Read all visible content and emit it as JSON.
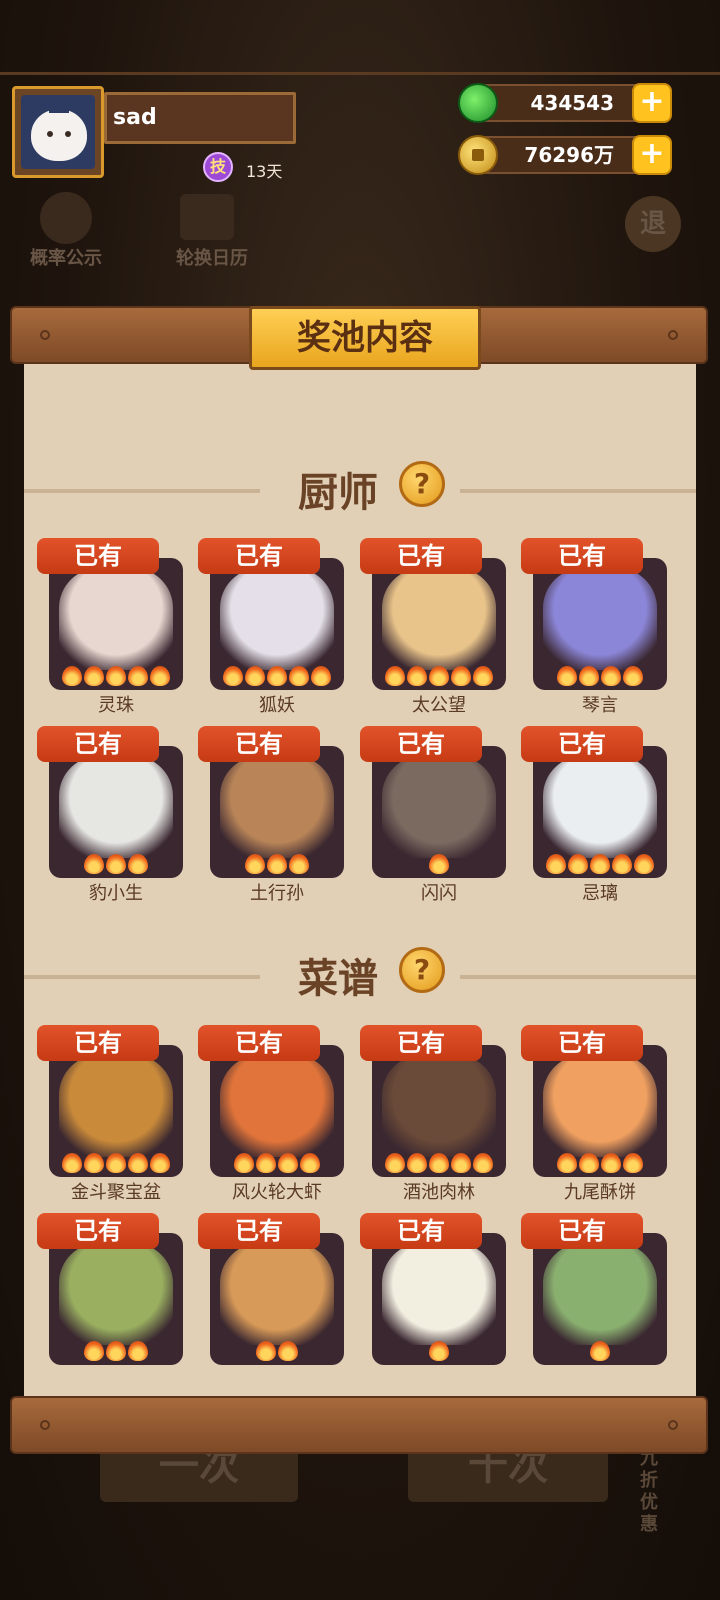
{
  "player": {
    "name": "sad",
    "skill_badge": "技",
    "skill_days": "13天"
  },
  "resources": {
    "jade": "434543",
    "coins": "76296万",
    "plus": "+"
  },
  "background": {
    "probability_label": "概率公示",
    "calendar_label": "轮换日历",
    "exit_label": "退",
    "single_draw": "一次",
    "ten_draw": "十次",
    "discount": "九折优惠"
  },
  "panel": {
    "title": "奖池内容",
    "sections": [
      {
        "title": "厨师",
        "help": "?"
      },
      {
        "title": "菜谱",
        "help": "?"
      }
    ]
  },
  "owned_label": "已有",
  "chefs": [
    {
      "name": "灵珠",
      "stars": 5,
      "art": "#e8d6d0"
    },
    {
      "name": "狐妖",
      "stars": 5,
      "art": "#e4dfe8"
    },
    {
      "name": "太公望",
      "stars": 5,
      "art": "#e9c48a"
    },
    {
      "name": "琴言",
      "stars": 4,
      "art": "#8c86d8"
    },
    {
      "name": "豹小生",
      "stars": 3,
      "art": "#e6e6e2"
    },
    {
      "name": "土行孙",
      "stars": 3,
      "art": "#b88458"
    },
    {
      "name": "闪闪",
      "stars": 1,
      "art": "#7a6a60"
    },
    {
      "name": "忌璃",
      "stars": 5,
      "art": "#eaeef0"
    }
  ],
  "recipes": [
    {
      "name": "金斗聚宝盆",
      "stars": 5,
      "art": "#c98a3a"
    },
    {
      "name": "风火轮大虾",
      "stars": 4,
      "art": "#e0743a"
    },
    {
      "name": "酒池肉林",
      "stars": 5,
      "art": "#6a4a38"
    },
    {
      "name": "九尾酥饼",
      "stars": 4,
      "art": "#f0a060"
    },
    {
      "name": "",
      "stars": 3,
      "art": "#9ab060"
    },
    {
      "name": "",
      "stars": 2,
      "art": "#d89a58"
    },
    {
      "name": "",
      "stars": 1,
      "art": "#f2eee0"
    },
    {
      "name": "",
      "stars": 1,
      "art": "#8ab070"
    }
  ]
}
